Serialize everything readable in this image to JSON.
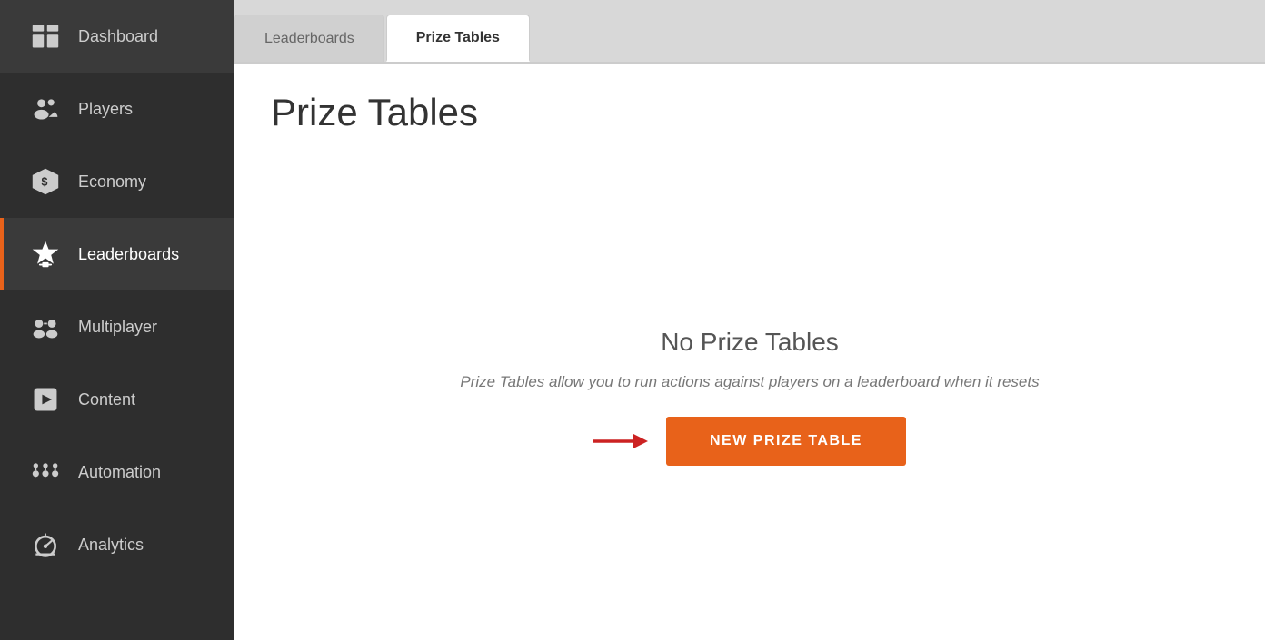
{
  "sidebar": {
    "items": [
      {
        "id": "dashboard",
        "label": "Dashboard"
      },
      {
        "id": "players",
        "label": "Players"
      },
      {
        "id": "economy",
        "label": "Economy"
      },
      {
        "id": "leaderboards",
        "label": "Leaderboards",
        "active": true
      },
      {
        "id": "multiplayer",
        "label": "Multiplayer"
      },
      {
        "id": "content",
        "label": "Content"
      },
      {
        "id": "automation",
        "label": "Automation"
      },
      {
        "id": "analytics",
        "label": "Analytics"
      }
    ]
  },
  "tabs": [
    {
      "id": "leaderboards",
      "label": "Leaderboards",
      "active": false
    },
    {
      "id": "prize-tables",
      "label": "Prize Tables",
      "active": true
    }
  ],
  "content": {
    "title": "Prize Tables",
    "empty_title": "No Prize Tables",
    "empty_description": "Prize Tables allow you to run actions against players on a leaderboard when it resets",
    "new_button_label": "NEW PRIZE TABLE"
  },
  "colors": {
    "accent": "#e8621a",
    "arrow": "#cc2222",
    "sidebar_bg": "#2e2e2e",
    "active_border": "#e8621a"
  }
}
